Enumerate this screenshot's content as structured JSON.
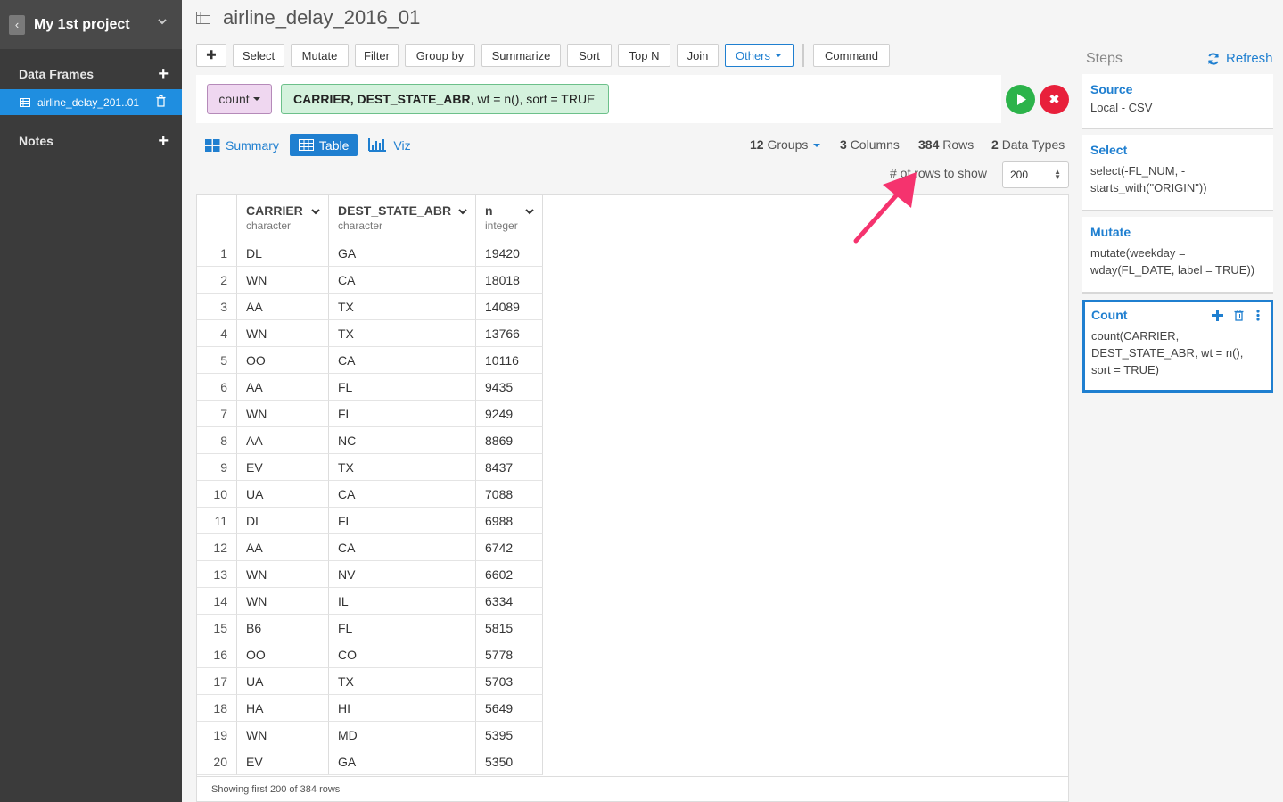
{
  "sidebar": {
    "project_name": "My 1st project",
    "data_frames_label": "Data Frames",
    "notes_label": "Notes",
    "data_frames": [
      {
        "label": "airline_delay_201..01"
      }
    ]
  },
  "page": {
    "title": "airline_delay_2016_01"
  },
  "toolbar": {
    "add": "✚",
    "buttons": [
      "Select",
      "Mutate",
      "Filter",
      "Group by",
      "Summarize",
      "Sort",
      "Top N",
      "Join",
      "Others"
    ],
    "command": "Command"
  },
  "command": {
    "function": "count",
    "args_bold": "CARRIER, DEST_STATE_ABR",
    "args_rest": ", wt = n(), sort = TRUE"
  },
  "view": {
    "tabs": [
      "Summary",
      "Table",
      "Viz"
    ],
    "active_tab": "Table",
    "groups": "12",
    "groups_label": "Groups",
    "columns": "3",
    "columns_label": "Columns",
    "rows": "384",
    "rows_label": "Rows",
    "types": "2",
    "types_label": "Data Types",
    "rows_to_show_label": "# of rows to show",
    "rows_to_show": "200"
  },
  "table": {
    "columns": [
      {
        "name": "CARRIER",
        "type": "character"
      },
      {
        "name": "DEST_STATE_ABR",
        "type": "character"
      },
      {
        "name": "n",
        "type": "integer"
      }
    ],
    "rows": [
      [
        "1",
        "DL",
        "GA",
        "19420"
      ],
      [
        "2",
        "WN",
        "CA",
        "18018"
      ],
      [
        "3",
        "AA",
        "TX",
        "14089"
      ],
      [
        "4",
        "WN",
        "TX",
        "13766"
      ],
      [
        "5",
        "OO",
        "CA",
        "10116"
      ],
      [
        "6",
        "AA",
        "FL",
        "9435"
      ],
      [
        "7",
        "WN",
        "FL",
        "9249"
      ],
      [
        "8",
        "AA",
        "NC",
        "8869"
      ],
      [
        "9",
        "EV",
        "TX",
        "8437"
      ],
      [
        "10",
        "UA",
        "CA",
        "7088"
      ],
      [
        "11",
        "DL",
        "FL",
        "6988"
      ],
      [
        "12",
        "AA",
        "CA",
        "6742"
      ],
      [
        "13",
        "WN",
        "NV",
        "6602"
      ],
      [
        "14",
        "WN",
        "IL",
        "6334"
      ],
      [
        "15",
        "B6",
        "FL",
        "5815"
      ],
      [
        "16",
        "OO",
        "CO",
        "5778"
      ],
      [
        "17",
        "UA",
        "TX",
        "5703"
      ],
      [
        "18",
        "HA",
        "HI",
        "5649"
      ],
      [
        "19",
        "WN",
        "MD",
        "5395"
      ],
      [
        "20",
        "EV",
        "GA",
        "5350"
      ]
    ],
    "footer": "Showing first 200 of 384 rows"
  },
  "steps": {
    "title": "Steps",
    "refresh": "Refresh",
    "items": [
      {
        "name": "Source",
        "body": "Local - CSV"
      },
      {
        "name": "Select",
        "body": "select(-FL_NUM, -starts_with(\"ORIGIN\"))"
      },
      {
        "name": "Mutate",
        "body": "mutate(weekday = wday(FL_DATE, label = TRUE))"
      },
      {
        "name": "Count",
        "body": "count(CARRIER, DEST_STATE_ABR, wt = n(), sort = TRUE)"
      }
    ]
  },
  "colors": {
    "accent": "#1f7fd0",
    "sidebar": "#3b3b3b",
    "active_df": "#1f8ee0",
    "annotation_arrow": "#f5336e",
    "run": "#2cb34a",
    "cancel": "#e8203b"
  }
}
